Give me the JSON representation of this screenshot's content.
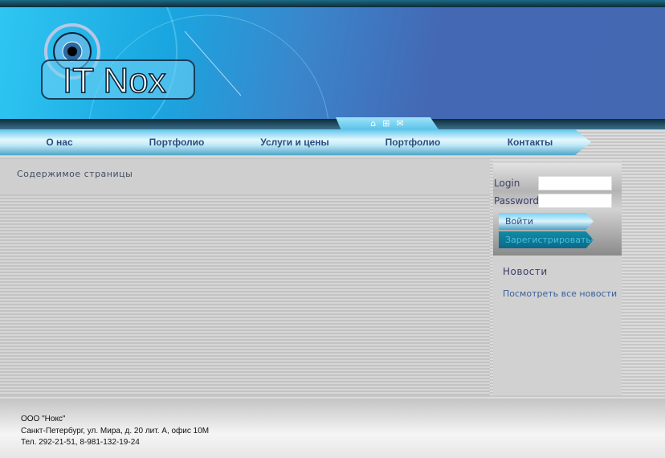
{
  "logo": {
    "text": "IT Nox"
  },
  "header_icons": [
    "home-icon",
    "sitemap-icon",
    "mail-icon"
  ],
  "nav": [
    {
      "label": "О нас"
    },
    {
      "label": "Портфолио"
    },
    {
      "label": "Услуги и цены"
    },
    {
      "label": "Портфолио"
    },
    {
      "label": "Контакты"
    }
  ],
  "content": {
    "title": "Содержимое страницы"
  },
  "login": {
    "login_label": "Login",
    "password_label": "Password",
    "login_value": "",
    "password_value": "",
    "submit": "Войти",
    "register": "Зарегистрироваться"
  },
  "news": {
    "title": "Новости",
    "all_link": "Посмотреть все новости"
  },
  "footer": {
    "company": "ООО \"Нокс\"",
    "address": "Санкт-Петербург, ул. Мира, д. 20 лит. А, офис 10М",
    "phone": "Тел. 292-21-51, 8-981-132-19-24"
  },
  "colors": {
    "nav_text": "#2c4b7e",
    "banner": "#4568b2",
    "accent": "#1aa6e0"
  }
}
